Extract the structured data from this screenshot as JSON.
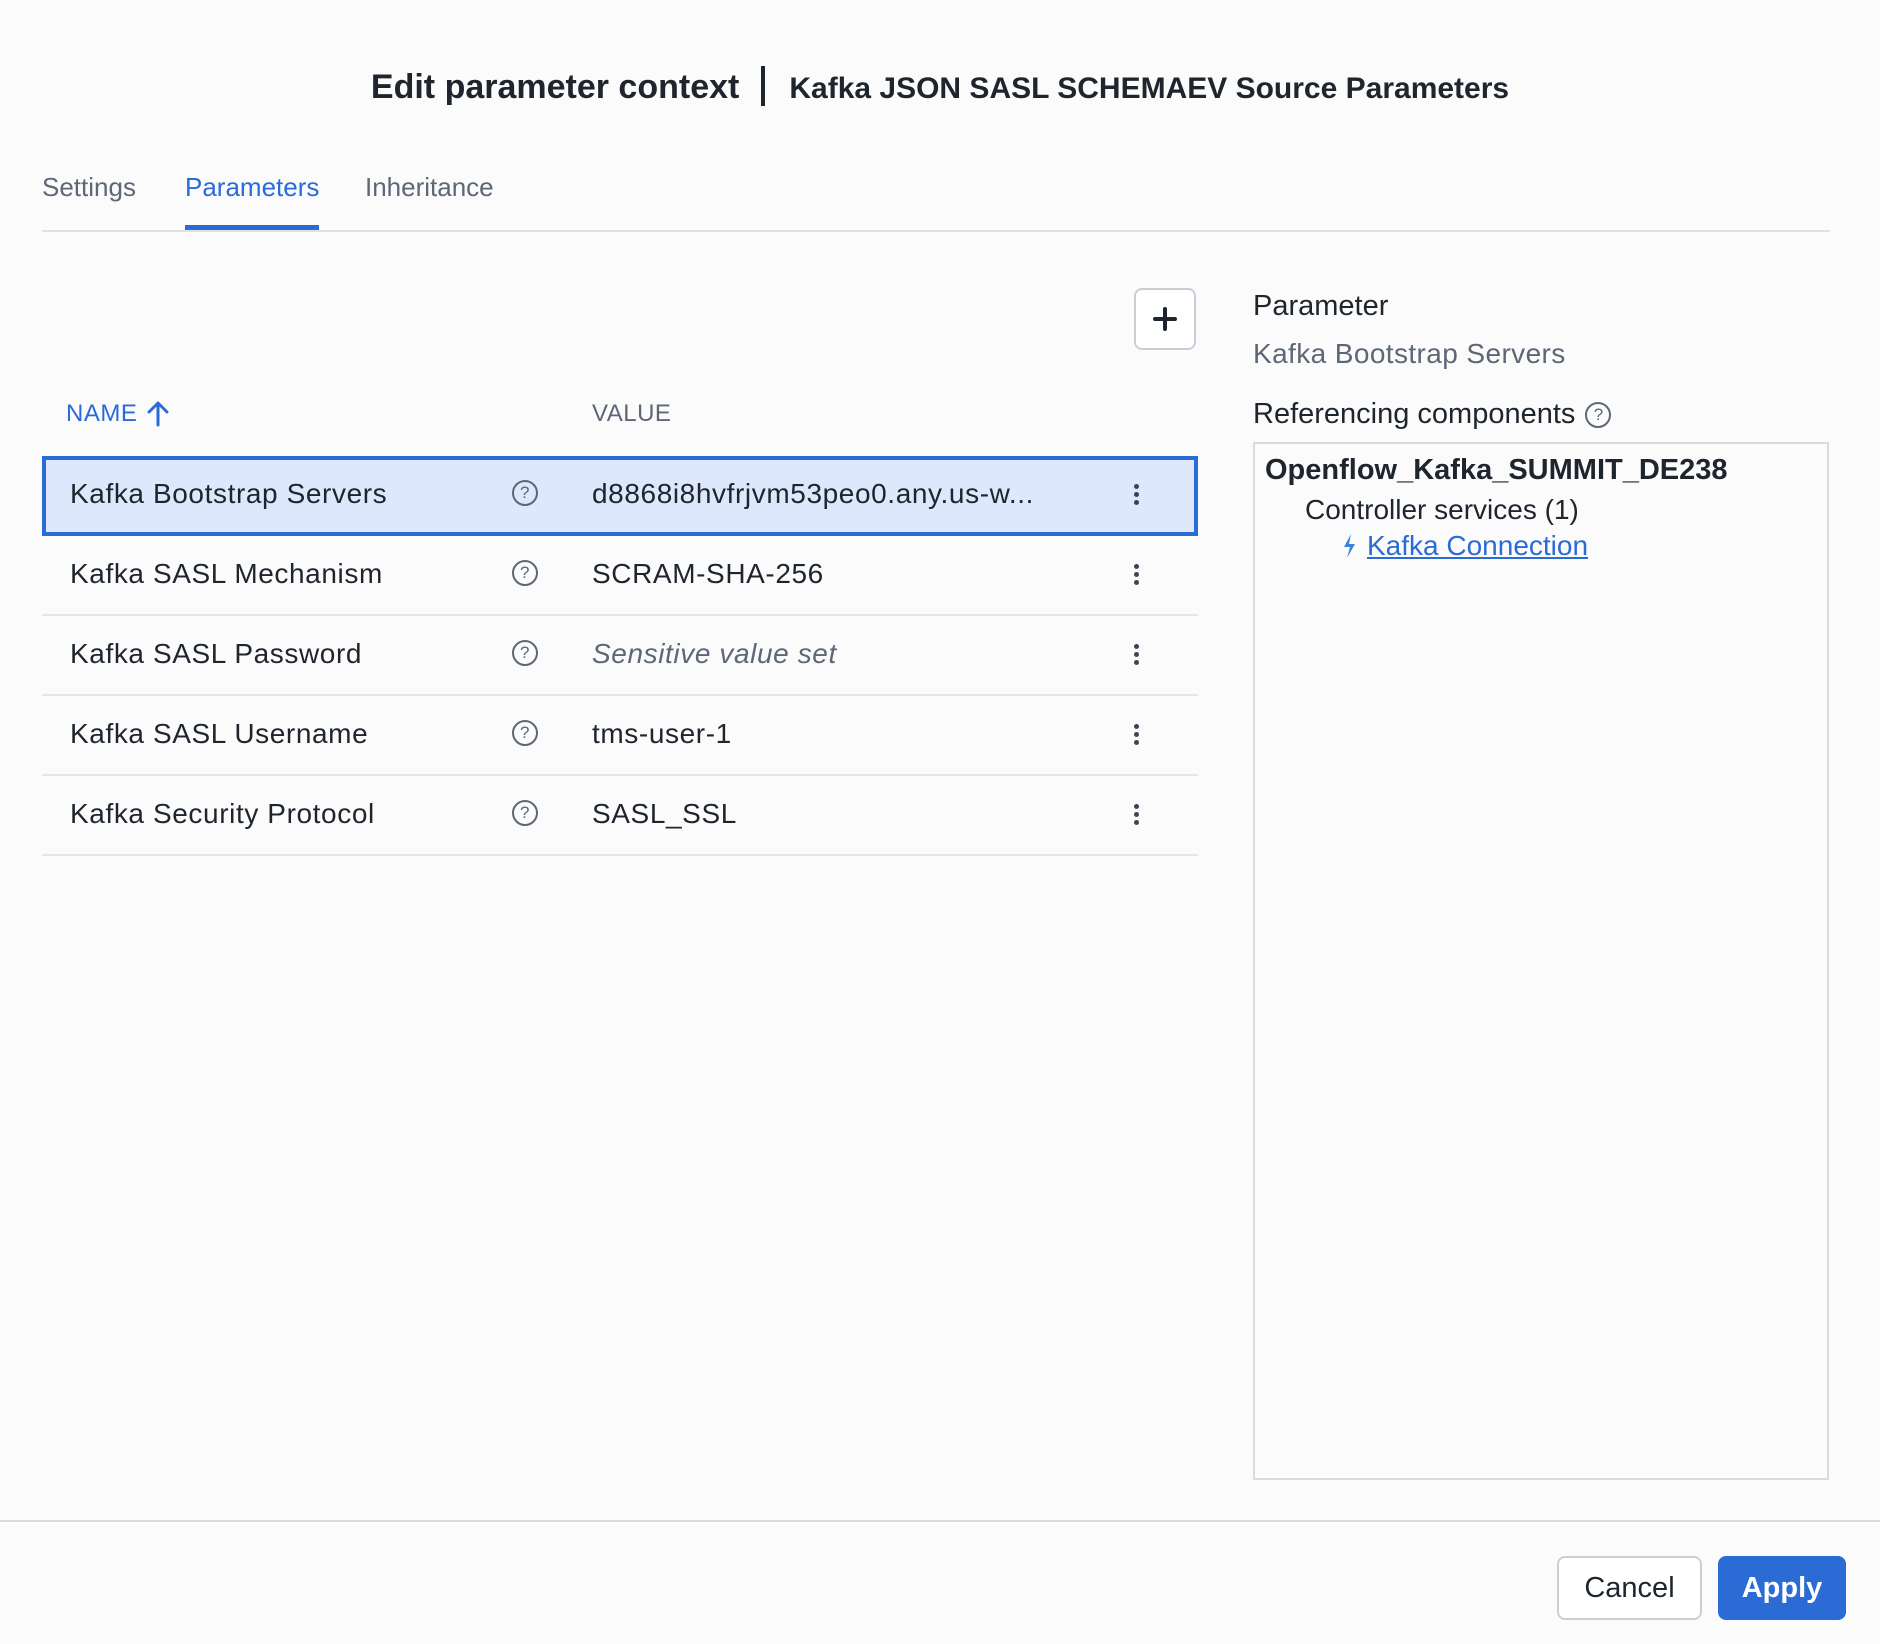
{
  "header": {
    "title": "Edit parameter context",
    "context_name": "Kafka JSON SASL SCHEMAEV Source Parameters"
  },
  "tabs": [
    {
      "label": "Settings",
      "active": false
    },
    {
      "label": "Parameters",
      "active": true
    },
    {
      "label": "Inheritance",
      "active": false
    }
  ],
  "add_button": {
    "icon": "plus-icon"
  },
  "table": {
    "columns": {
      "name": "NAME",
      "value": "VALUE"
    },
    "sort": {
      "column": "NAME",
      "direction": "ascending"
    },
    "rows": [
      {
        "name": "Kafka Bootstrap Servers",
        "value": "d8868i8hvfrjvm53peo0.any.us-w...",
        "selected": true
      },
      {
        "name": "Kafka SASL Mechanism",
        "value": "SCRAM-SHA-256"
      },
      {
        "name": "Kafka SASL Password",
        "value": "Sensitive value set",
        "sensitive": true
      },
      {
        "name": "Kafka SASL Username",
        "value": "tms-user-1"
      },
      {
        "name": "Kafka Security Protocol",
        "value": "SASL_SSL"
      }
    ]
  },
  "details": {
    "parameter_label": "Parameter",
    "parameter_name": "Kafka Bootstrap Servers",
    "referencing_label": "Referencing components",
    "process_group": "Openflow_Kafka_SUMMIT_DE238",
    "controller_services_label": "Controller services (1)",
    "service_link": "Kafka Connection"
  },
  "footer": {
    "cancel_label": "Cancel",
    "apply_label": "Apply"
  },
  "colors": {
    "accent": "#2a6bd6",
    "selected_row": "#dde8fc"
  }
}
